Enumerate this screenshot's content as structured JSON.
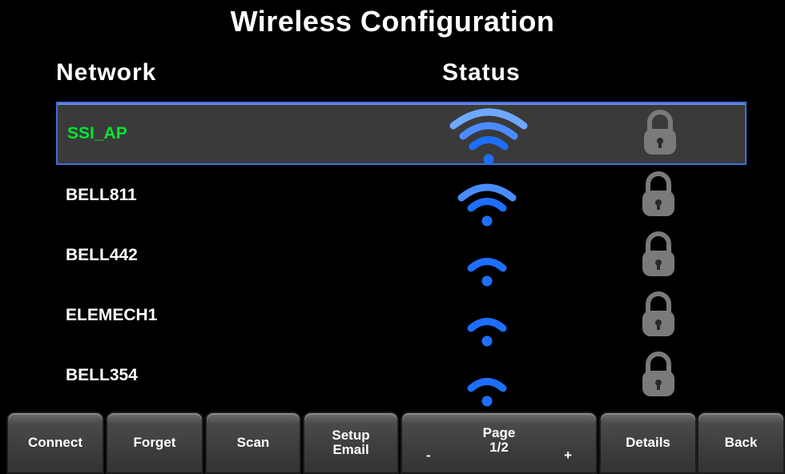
{
  "title": "Wireless Configuration",
  "columns": {
    "network": "Network",
    "status": "Status"
  },
  "networks": [
    {
      "name": "SSI_AP",
      "signal_bars": 4,
      "locked": true,
      "selected": true
    },
    {
      "name": "BELL811",
      "signal_bars": 3,
      "locked": true,
      "selected": false
    },
    {
      "name": "BELL442",
      "signal_bars": 2,
      "locked": true,
      "selected": false
    },
    {
      "name": "ELEMECH1",
      "signal_bars": 2,
      "locked": true,
      "selected": false
    },
    {
      "name": "BELL354",
      "signal_bars": 2,
      "locked": true,
      "selected": false
    }
  ],
  "colors": {
    "selected_text": "#00e632",
    "selection_border": "#3f6fd8",
    "wifi_blue": "#1e6fff",
    "lock_gray": "#7a7a7a"
  },
  "buttons": {
    "connect": "Connect",
    "forget": "Forget",
    "scan": "Scan",
    "setup_email_line1": "Setup",
    "setup_email_line2": "Email",
    "page_label": "Page",
    "page_value": "1/2",
    "page_minus": "-",
    "page_plus": "+",
    "details": "Details",
    "back": "Back"
  }
}
